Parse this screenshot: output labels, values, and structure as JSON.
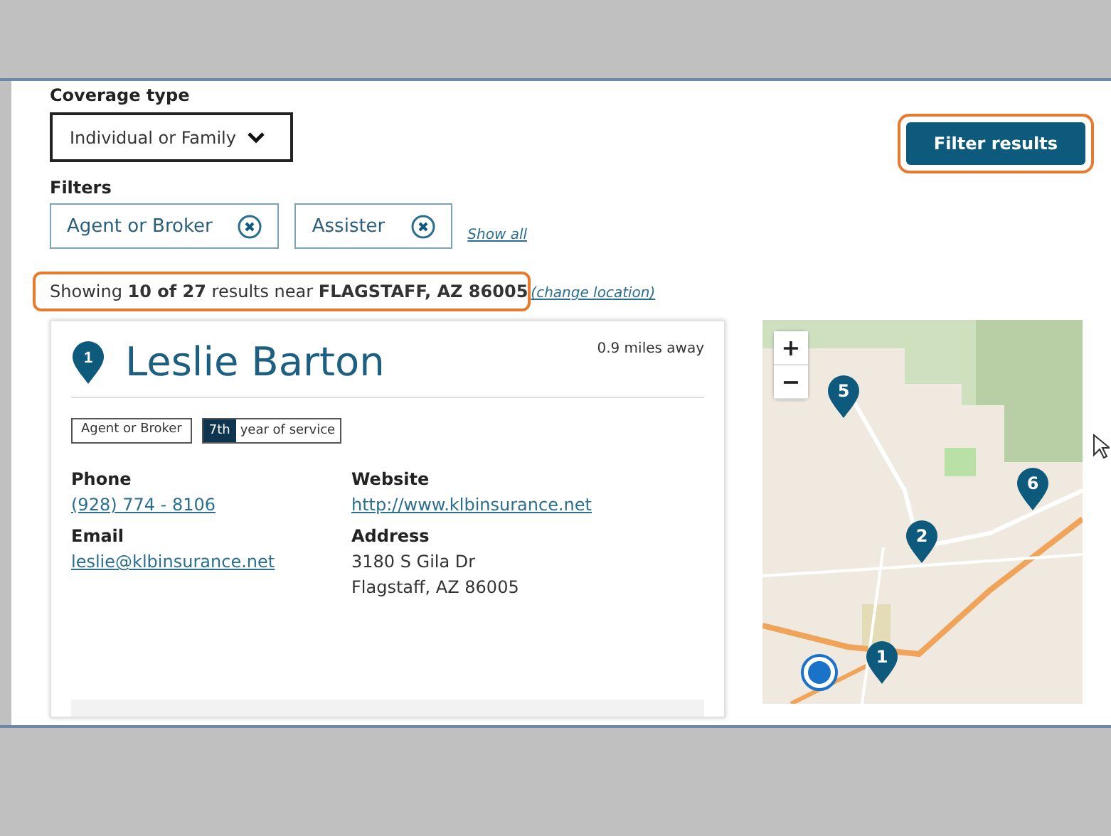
{
  "coverage": {
    "label": "Coverage type",
    "value": "Individual or Family"
  },
  "filter_button": "Filter results",
  "filters": {
    "label": "Filters",
    "chips": [
      {
        "label": "Agent or Broker"
      },
      {
        "label": "Assister"
      }
    ],
    "show_all": "Show all"
  },
  "summary": {
    "text": "Showing **10 of 27** results near **FLAGSTAFF, AZ 86005**",
    "link": "(change location)"
  },
  "result": {
    "pin": "1",
    "name": "Leslie Barton",
    "distance": "0.9 miles away",
    "tag": "Agent or Broker",
    "years": "7th",
    "years_label": "year of service",
    "fields": [
      {
        "label": "Phone",
        "kind": "link",
        "lines": [
          "(928) 774 - 8106"
        ]
      },
      {
        "label": "Website",
        "kind": "link",
        "lines": [
          "http://www.klbinsurance.net"
        ]
      },
      {
        "label": "Email",
        "kind": "link",
        "lines": [
          "leslie@klbinsurance.net"
        ]
      },
      {
        "label": "Address",
        "kind": "text",
        "lines": [
          "3180 S Gila Dr",
          "Flagstaff, AZ 86005"
        ]
      }
    ]
  },
  "map": {
    "zoom_in": "+",
    "zoom_out": "−",
    "pins": [
      {
        "label": "5"
      },
      {
        "label": "6"
      },
      {
        "label": "2"
      },
      {
        "label": "1"
      }
    ]
  }
}
